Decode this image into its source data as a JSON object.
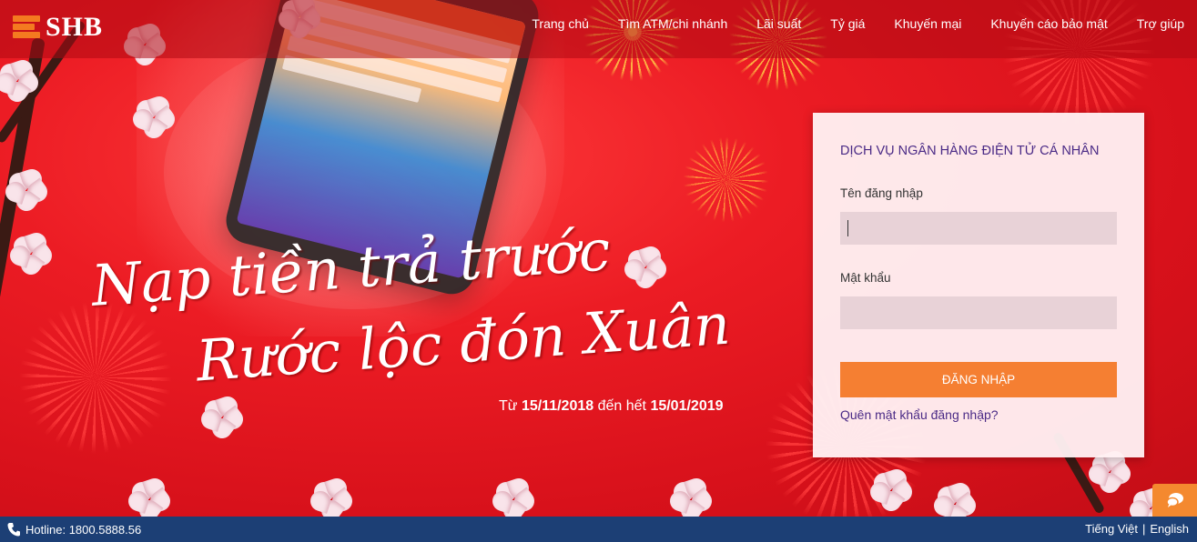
{
  "brand": {
    "name": "SHB",
    "accent": "#f47a20",
    "primary": "#e2121d"
  },
  "nav": {
    "items": [
      {
        "label": "Trang chủ"
      },
      {
        "label": "Tìm ATM/chi nhánh"
      },
      {
        "label": "Lãi suất"
      },
      {
        "label": "Tỷ giá"
      },
      {
        "label": "Khuyến mại"
      },
      {
        "label": "Khuyến cáo bảo mật"
      },
      {
        "label": "Trợ giúp"
      }
    ]
  },
  "hero": {
    "headline_line1": "Nạp tiền trả trước",
    "headline_line2": "Rước lộc đón Xuân",
    "date_prefix": "Từ",
    "date_start": "15/11/2018",
    "date_middle": "đến hết",
    "date_end": "15/01/2019"
  },
  "login": {
    "title": "DỊCH VỤ NGÂN HÀNG ĐIỆN TỬ CÁ NHÂN",
    "username_label": "Tên đăng nhập",
    "username_value": "",
    "password_label": "Mật khẩu",
    "password_value": "",
    "submit_label": "ĐĂNG NHẬP",
    "forgot_label": "Quên mật khẩu đăng nhập?",
    "button_color": "#f57f32",
    "title_color": "#4a2a86"
  },
  "chat": {
    "icon": "chat-bubble-icon"
  },
  "footer": {
    "hotline_icon": "phone-icon",
    "hotline_label": "Hotline: 1800.5888.56",
    "lang_vi": "Tiếng Việt",
    "lang_sep": "|",
    "lang_en": "English",
    "bg_color": "#1c3f75"
  }
}
